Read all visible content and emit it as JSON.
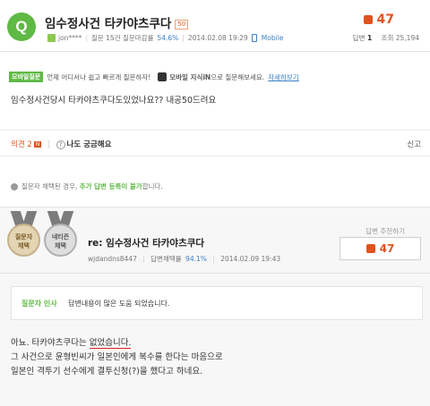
{
  "question": {
    "avatar_letter": "Q",
    "title": "임수정사건 타카야츠쿠다",
    "badge": "50",
    "author": "jon****",
    "meta_text": "질문 15건 질문마감률",
    "rate": "54.6%",
    "datetime": "2014.02.08 19:29",
    "mobile": "Mobile",
    "likes": "47",
    "answers_label": "답변",
    "answers_count": "1",
    "views_label": "조회",
    "views_count": "25,194",
    "body": "임수정사건당시 타카야츠쿠다도있었나요?? 내공50드려요"
  },
  "mobile_bar": {
    "tag": "모바일질문",
    "text": "언제 어디서나 쉽고 빠르게 질문하자!",
    "app_name": "모바일 지식iN",
    "app_text": "으로 질문해보세요.",
    "link": "자세히보기"
  },
  "actions": {
    "opinion": "의견",
    "opinion_count": "2",
    "curious": "나도 궁금해요",
    "report": "신고"
  },
  "notice": {
    "prefix": "질문자 채택된 경우,",
    "highlight": "추가 답변 등록이 불가",
    "suffix": "합니다."
  },
  "answer": {
    "medal1": "질문자\n채택",
    "medal2": "네티즌\n채택",
    "title": "re: 임수정사건 타카야츠쿠다",
    "author": "wjdandns8447",
    "meta_text": "답변채택률",
    "rate": "94.1%",
    "datetime": "2014.02.09 19:43",
    "recommend_label": "답변 추천하기",
    "likes": "47",
    "thanks_label": "질문자 인사",
    "thanks_text": "답변내용이 많은 도움 되었습니다.",
    "body_line1_a": "아뇨. 타카야츠쿠다는 ",
    "body_line1_b": "없었습니다.",
    "body_line2": "그 사건으로 윤형빈씨가 일본인에게 복수를 한다는 마음으로",
    "body_line3": "일본인 격투기 선수에게 결투신청(?)을 했다고 하네요."
  }
}
